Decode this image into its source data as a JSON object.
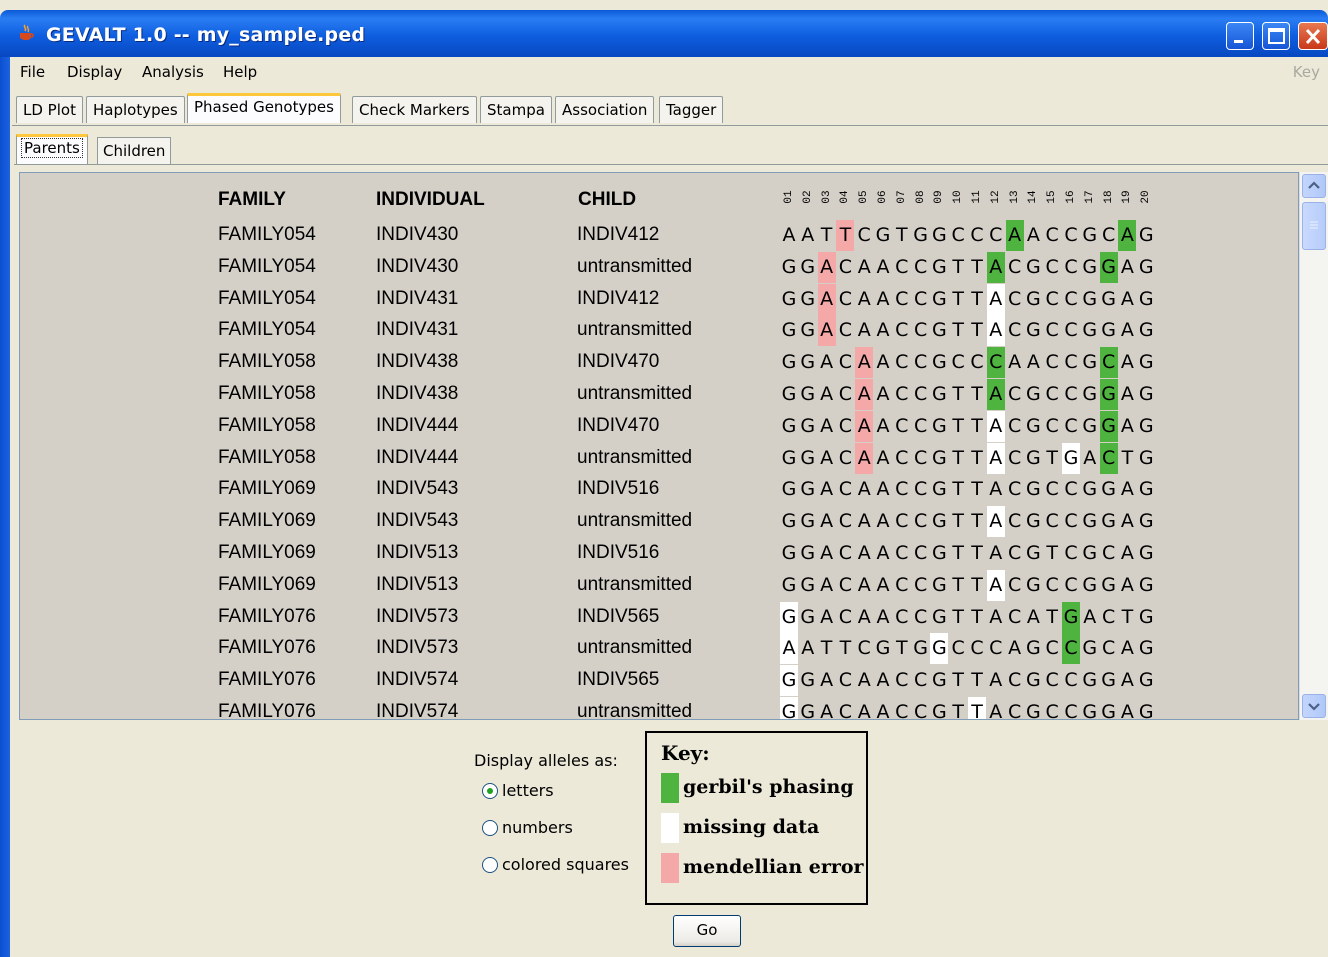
{
  "window": {
    "title": "GEVALT 1.0 -- my_sample.ped"
  },
  "menu": {
    "items": [
      "File",
      "Display",
      "Analysis",
      "Help"
    ],
    "right_hint": "Key"
  },
  "tabs": [
    "LD Plot",
    "Haplotypes",
    "Phased Genotypes",
    "Check Markers",
    "Stampa",
    "Association",
    "Tagger"
  ],
  "active_tab": "Phased Genotypes",
  "subtabs": [
    "Parents",
    "Children"
  ],
  "active_subtab": "Parents",
  "table": {
    "headers": {
      "family": "FAMILY",
      "individual": "INDIVIDUAL",
      "child": "CHILD"
    },
    "markers": [
      "01",
      "02",
      "03",
      "04",
      "05",
      "06",
      "07",
      "08",
      "09",
      "10",
      "11",
      "12",
      "13",
      "14",
      "15",
      "16",
      "17",
      "18",
      "19",
      "20"
    ],
    "rows": [
      {
        "family": "FAMILY054",
        "individual": "INDIV430",
        "child": "INDIV412",
        "alleles": "AATTCGTGGCCCAACCGCAG",
        "marks": "...r........g.....g.."
      },
      {
        "family": "FAMILY054",
        "individual": "INDIV430",
        "child": "untransmitted",
        "alleles": "GGACAACCGTTACGCCGGAG",
        "marks": "..r........g.....g.."
      },
      {
        "family": "FAMILY054",
        "individual": "INDIV431",
        "child": "INDIV412",
        "alleles": "GGACAACCGTTACGCCGGAG",
        "marks": "..r........w........"
      },
      {
        "family": "FAMILY054",
        "individual": "INDIV431",
        "child": "untransmitted",
        "alleles": "GGACAACCGTTACGCCGGAG",
        "marks": "..r........w........"
      },
      {
        "family": "FAMILY058",
        "individual": "INDIV438",
        "child": "INDIV470",
        "alleles": "GGACAACCGCCCAACCGCAG",
        "marks": "....r......g.....g.."
      },
      {
        "family": "FAMILY058",
        "individual": "INDIV438",
        "child": "untransmitted",
        "alleles": "GGACAACCGTTACGCCGGAG",
        "marks": "....r......g.....g.."
      },
      {
        "family": "FAMILY058",
        "individual": "INDIV444",
        "child": "INDIV470",
        "alleles": "GGACAACCGTTACGCCGGAG",
        "marks": "....r......w.....g.."
      },
      {
        "family": "FAMILY058",
        "individual": "INDIV444",
        "child": "untransmitted",
        "alleles": "GGACAACCGTTACGTGACTG",
        "marks": "....r......w...w.g.."
      },
      {
        "family": "FAMILY069",
        "individual": "INDIV543",
        "child": "INDIV516",
        "alleles": "GGACAACCGTTACGCCGGAG",
        "marks": "...................."
      },
      {
        "family": "FAMILY069",
        "individual": "INDIV543",
        "child": "untransmitted",
        "alleles": "GGACAACCGTTACGCCGGAG",
        "marks": "...........w........"
      },
      {
        "family": "FAMILY069",
        "individual": "INDIV513",
        "child": "INDIV516",
        "alleles": "GGACAACCGTTACGTCGCAG",
        "marks": "...................."
      },
      {
        "family": "FAMILY069",
        "individual": "INDIV513",
        "child": "untransmitted",
        "alleles": "GGACAACCGTTACGCCGGAG",
        "marks": "...........w........"
      },
      {
        "family": "FAMILY076",
        "individual": "INDIV573",
        "child": "INDIV565",
        "alleles": "GGACAACCGTTACATGACTG",
        "marks": "w..............g...."
      },
      {
        "family": "FAMILY076",
        "individual": "INDIV573",
        "child": "untransmitted",
        "alleles": "AATTCGTGGCCCAGCCGCAG",
        "marks": "w.......w......g...."
      },
      {
        "family": "FAMILY076",
        "individual": "INDIV574",
        "child": "INDIV565",
        "alleles": "GGACAACCGTTACGCCGGAG",
        "marks": "w..................."
      },
      {
        "family": "FAMILY076",
        "individual": "INDIV574",
        "child": "untransmitted",
        "alleles": "GGACAACCGTTACGCCGGAG",
        "marks": "w.........w........."
      }
    ]
  },
  "display_options": {
    "label": "Display alleles as:",
    "options": [
      "letters",
      "numbers",
      "colored squares"
    ],
    "selected": "letters"
  },
  "key": {
    "title": "Key:",
    "entries": [
      {
        "label": "gerbil's phasing",
        "color": "#4fb340"
      },
      {
        "label": "missing data",
        "color": "#ffffff"
      },
      {
        "label": "mendellian error",
        "color": "#f4a9a8"
      }
    ]
  },
  "go_button": "Go"
}
